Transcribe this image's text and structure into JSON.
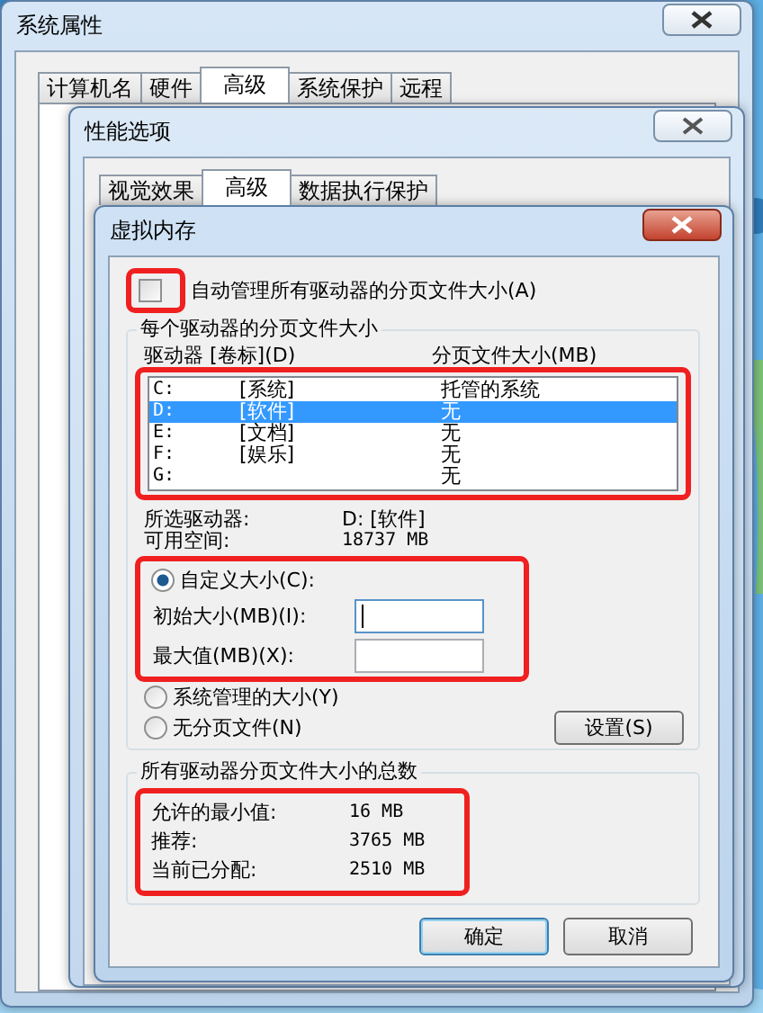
{
  "system_properties": {
    "title": "系统属性",
    "tabs": [
      {
        "label": "计算机名",
        "selected": false
      },
      {
        "label": "硬件",
        "selected": false
      },
      {
        "label": "高级",
        "selected": true
      },
      {
        "label": "系统保护",
        "selected": false
      },
      {
        "label": "远程",
        "selected": false
      }
    ]
  },
  "performance_options": {
    "title": "性能选项",
    "tabs": [
      {
        "label": "视觉效果",
        "selected": false
      },
      {
        "label": "高级",
        "selected": true
      },
      {
        "label": "数据执行保护",
        "selected": false
      }
    ]
  },
  "virtual_memory": {
    "title": "虚拟内存",
    "auto_manage": {
      "label": "自动管理所有驱动器的分页文件大小(A)",
      "checked": false
    },
    "per_drive_group": "每个驱动器的分页文件大小",
    "columns": [
      "驱动器 [卷标](D)",
      "分页文件大小(MB)"
    ],
    "drives": [
      {
        "drive": "C:",
        "label": "[系统]",
        "size": "托管的系统",
        "selected": false
      },
      {
        "drive": "D:",
        "label": "[软件]",
        "size": "无",
        "selected": true
      },
      {
        "drive": "E:",
        "label": "[文档]",
        "size": "无",
        "selected": false
      },
      {
        "drive": "F:",
        "label": "[娱乐]",
        "size": "无",
        "selected": false
      },
      {
        "drive": "G:",
        "size": "无",
        "selected": false
      }
    ],
    "selected_drive": {
      "label": "所选驱动器:",
      "value": "D:  [软件]"
    },
    "free_space": {
      "label": "可用空间:",
      "value": "18737 MB"
    },
    "size_options": [
      {
        "kind": "custom",
        "label": "自定义大小(C):",
        "selected": true,
        "fields": [
          {
            "label": "初始大小(MB)(I):",
            "focused": true
          },
          {
            "label": "最大值(MB)(X):",
            "focused": false
          }
        ]
      },
      {
        "kind": "plain",
        "label": "系统管理的大小(Y)",
        "selected": false
      },
      {
        "kind": "set",
        "label": "无分页文件(N)",
        "selected": false,
        "button": "设置(S)"
      }
    ],
    "totals_group": "所有驱动器分页文件大小的总数",
    "totals": [
      {
        "label": "允许的最小值:",
        "value": "16 MB"
      },
      {
        "label": "推荐:",
        "value": "3765 MB"
      },
      {
        "label": "当前已分配:",
        "value": "2510 MB"
      }
    ],
    "buttons": [
      {
        "label": "确定",
        "default": true
      },
      {
        "label": "取消",
        "default": false
      }
    ]
  }
}
